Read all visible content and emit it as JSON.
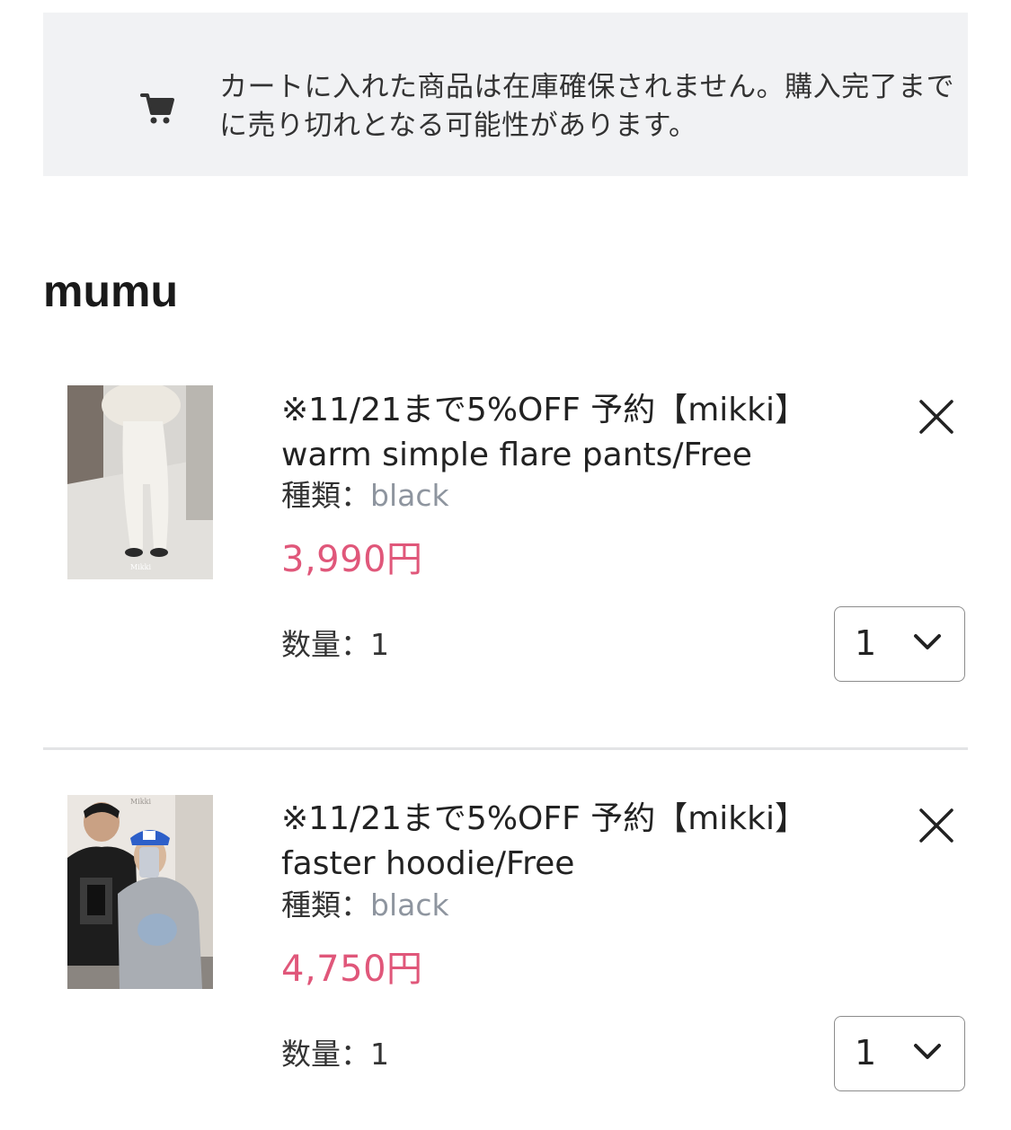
{
  "notice": {
    "icon": "cart-icon",
    "text": "カートに入れた商品は在庫確保されません。購入完了までに売り切れとなる可能性があります。"
  },
  "shop": {
    "name": "mumu"
  },
  "items": [
    {
      "title": "※11/21まで5%OFF 予約【mikki】warm simple flare pants/Free",
      "variant_label": "種類：",
      "variant_value": "black",
      "price": "3,990円",
      "qty_label": "数量：1",
      "qty_selected": "1",
      "remove_icon": "close-icon",
      "thumb_caption": "Mikki"
    },
    {
      "title": "※11/21まで5%OFF 予約【mikki】faster hoodie/Free",
      "variant_label": "種類：",
      "variant_value": "black",
      "price": "4,750円",
      "qty_label": "数量：1",
      "qty_selected": "1",
      "remove_icon": "close-icon",
      "thumb_caption": "Mikki"
    }
  ],
  "colors": {
    "price": "#e0577a",
    "variant_value": "#8e959f",
    "notice_bg": "#f1f2f4"
  }
}
